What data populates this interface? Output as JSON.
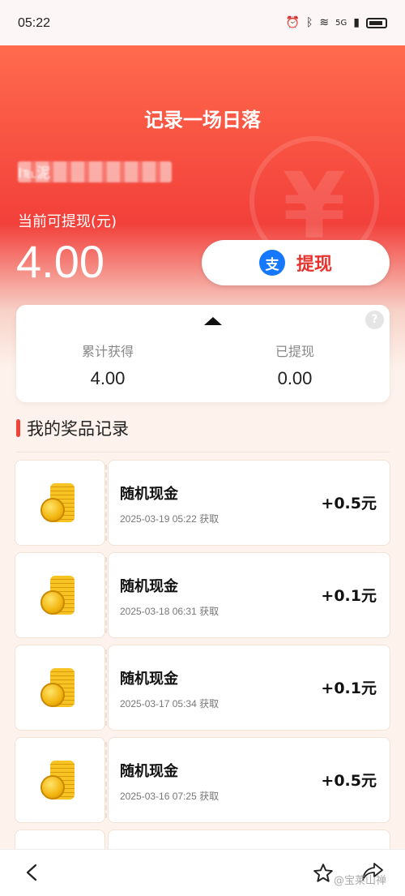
{
  "status_bar": {
    "time": "05:22",
    "icons": [
      "alarm-icon",
      "bluetooth-icon",
      "wifi-icon",
      "signal-icon",
      "battery-icon"
    ],
    "network": "5G"
  },
  "header": {
    "title": "记录一场日落",
    "user_name": "I℡泥"
  },
  "balance": {
    "label": "当前可提现(元)",
    "value": "4.00"
  },
  "withdraw_button": {
    "label": "提现",
    "icon_text": "支"
  },
  "stats": {
    "total_label": "累计获得",
    "total_value": "4.00",
    "withdrawn_label": "已提现",
    "withdrawn_value": "0.00",
    "help_symbol": "?"
  },
  "section": {
    "title": "我的奖品记录"
  },
  "records": [
    {
      "name": "随机现金",
      "time": "2025-03-19 05:22 获取",
      "amount": "+0.5元"
    },
    {
      "name": "随机现金",
      "time": "2025-03-18 06:31 获取",
      "amount": "+0.1元"
    },
    {
      "name": "随机现金",
      "time": "2025-03-17 05:34 获取",
      "amount": "+0.1元"
    },
    {
      "name": "随机现金",
      "time": "2025-03-16 07:25 获取",
      "amount": "+0.5元"
    }
  ],
  "bottom_bar": {
    "watermark": "@宝莱山禅"
  },
  "colors": {
    "accent": "#f2403a",
    "alipay": "#1677ff"
  }
}
